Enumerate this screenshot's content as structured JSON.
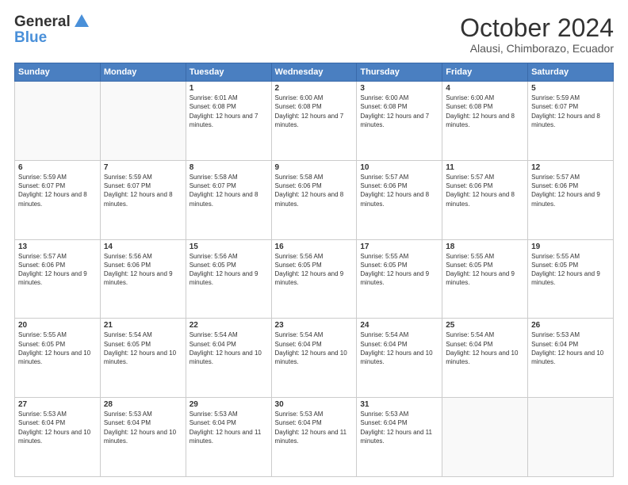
{
  "header": {
    "logo_line1": "General",
    "logo_line2": "Blue",
    "month": "October 2024",
    "location": "Alausi, Chimborazo, Ecuador"
  },
  "weekdays": [
    "Sunday",
    "Monday",
    "Tuesday",
    "Wednesday",
    "Thursday",
    "Friday",
    "Saturday"
  ],
  "weeks": [
    [
      {
        "day": "",
        "empty": true
      },
      {
        "day": "",
        "empty": true
      },
      {
        "day": "1",
        "sunrise": "Sunrise: 6:01 AM",
        "sunset": "Sunset: 6:08 PM",
        "daylight": "Daylight: 12 hours and 7 minutes."
      },
      {
        "day": "2",
        "sunrise": "Sunrise: 6:00 AM",
        "sunset": "Sunset: 6:08 PM",
        "daylight": "Daylight: 12 hours and 7 minutes."
      },
      {
        "day": "3",
        "sunrise": "Sunrise: 6:00 AM",
        "sunset": "Sunset: 6:08 PM",
        "daylight": "Daylight: 12 hours and 7 minutes."
      },
      {
        "day": "4",
        "sunrise": "Sunrise: 6:00 AM",
        "sunset": "Sunset: 6:08 PM",
        "daylight": "Daylight: 12 hours and 8 minutes."
      },
      {
        "day": "5",
        "sunrise": "Sunrise: 5:59 AM",
        "sunset": "Sunset: 6:07 PM",
        "daylight": "Daylight: 12 hours and 8 minutes."
      }
    ],
    [
      {
        "day": "6",
        "sunrise": "Sunrise: 5:59 AM",
        "sunset": "Sunset: 6:07 PM",
        "daylight": "Daylight: 12 hours and 8 minutes."
      },
      {
        "day": "7",
        "sunrise": "Sunrise: 5:59 AM",
        "sunset": "Sunset: 6:07 PM",
        "daylight": "Daylight: 12 hours and 8 minutes."
      },
      {
        "day": "8",
        "sunrise": "Sunrise: 5:58 AM",
        "sunset": "Sunset: 6:07 PM",
        "daylight": "Daylight: 12 hours and 8 minutes."
      },
      {
        "day": "9",
        "sunrise": "Sunrise: 5:58 AM",
        "sunset": "Sunset: 6:06 PM",
        "daylight": "Daylight: 12 hours and 8 minutes."
      },
      {
        "day": "10",
        "sunrise": "Sunrise: 5:57 AM",
        "sunset": "Sunset: 6:06 PM",
        "daylight": "Daylight: 12 hours and 8 minutes."
      },
      {
        "day": "11",
        "sunrise": "Sunrise: 5:57 AM",
        "sunset": "Sunset: 6:06 PM",
        "daylight": "Daylight: 12 hours and 8 minutes."
      },
      {
        "day": "12",
        "sunrise": "Sunrise: 5:57 AM",
        "sunset": "Sunset: 6:06 PM",
        "daylight": "Daylight: 12 hours and 9 minutes."
      }
    ],
    [
      {
        "day": "13",
        "sunrise": "Sunrise: 5:57 AM",
        "sunset": "Sunset: 6:06 PM",
        "daylight": "Daylight: 12 hours and 9 minutes."
      },
      {
        "day": "14",
        "sunrise": "Sunrise: 5:56 AM",
        "sunset": "Sunset: 6:06 PM",
        "daylight": "Daylight: 12 hours and 9 minutes."
      },
      {
        "day": "15",
        "sunrise": "Sunrise: 5:56 AM",
        "sunset": "Sunset: 6:05 PM",
        "daylight": "Daylight: 12 hours and 9 minutes."
      },
      {
        "day": "16",
        "sunrise": "Sunrise: 5:56 AM",
        "sunset": "Sunset: 6:05 PM",
        "daylight": "Daylight: 12 hours and 9 minutes."
      },
      {
        "day": "17",
        "sunrise": "Sunrise: 5:55 AM",
        "sunset": "Sunset: 6:05 PM",
        "daylight": "Daylight: 12 hours and 9 minutes."
      },
      {
        "day": "18",
        "sunrise": "Sunrise: 5:55 AM",
        "sunset": "Sunset: 6:05 PM",
        "daylight": "Daylight: 12 hours and 9 minutes."
      },
      {
        "day": "19",
        "sunrise": "Sunrise: 5:55 AM",
        "sunset": "Sunset: 6:05 PM",
        "daylight": "Daylight: 12 hours and 9 minutes."
      }
    ],
    [
      {
        "day": "20",
        "sunrise": "Sunrise: 5:55 AM",
        "sunset": "Sunset: 6:05 PM",
        "daylight": "Daylight: 12 hours and 10 minutes."
      },
      {
        "day": "21",
        "sunrise": "Sunrise: 5:54 AM",
        "sunset": "Sunset: 6:05 PM",
        "daylight": "Daylight: 12 hours and 10 minutes."
      },
      {
        "day": "22",
        "sunrise": "Sunrise: 5:54 AM",
        "sunset": "Sunset: 6:04 PM",
        "daylight": "Daylight: 12 hours and 10 minutes."
      },
      {
        "day": "23",
        "sunrise": "Sunrise: 5:54 AM",
        "sunset": "Sunset: 6:04 PM",
        "daylight": "Daylight: 12 hours and 10 minutes."
      },
      {
        "day": "24",
        "sunrise": "Sunrise: 5:54 AM",
        "sunset": "Sunset: 6:04 PM",
        "daylight": "Daylight: 12 hours and 10 minutes."
      },
      {
        "day": "25",
        "sunrise": "Sunrise: 5:54 AM",
        "sunset": "Sunset: 6:04 PM",
        "daylight": "Daylight: 12 hours and 10 minutes."
      },
      {
        "day": "26",
        "sunrise": "Sunrise: 5:53 AM",
        "sunset": "Sunset: 6:04 PM",
        "daylight": "Daylight: 12 hours and 10 minutes."
      }
    ],
    [
      {
        "day": "27",
        "sunrise": "Sunrise: 5:53 AM",
        "sunset": "Sunset: 6:04 PM",
        "daylight": "Daylight: 12 hours and 10 minutes."
      },
      {
        "day": "28",
        "sunrise": "Sunrise: 5:53 AM",
        "sunset": "Sunset: 6:04 PM",
        "daylight": "Daylight: 12 hours and 10 minutes."
      },
      {
        "day": "29",
        "sunrise": "Sunrise: 5:53 AM",
        "sunset": "Sunset: 6:04 PM",
        "daylight": "Daylight: 12 hours and 11 minutes."
      },
      {
        "day": "30",
        "sunrise": "Sunrise: 5:53 AM",
        "sunset": "Sunset: 6:04 PM",
        "daylight": "Daylight: 12 hours and 11 minutes."
      },
      {
        "day": "31",
        "sunrise": "Sunrise: 5:53 AM",
        "sunset": "Sunset: 6:04 PM",
        "daylight": "Daylight: 12 hours and 11 minutes."
      },
      {
        "day": "",
        "empty": true
      },
      {
        "day": "",
        "empty": true
      }
    ]
  ]
}
